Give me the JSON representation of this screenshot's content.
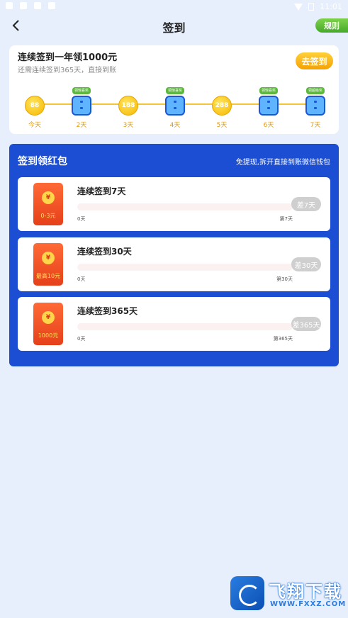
{
  "status_bar": {
    "time": "11:01"
  },
  "header": {
    "title": "签到",
    "rules_label": "规则"
  },
  "signin": {
    "title": "连续签到一年领1000元",
    "subtitle": "还需连续签到365天，直接到账",
    "button_label": "去签到",
    "days": [
      {
        "type": "coin",
        "value": "88",
        "label": "今天",
        "tag": ""
      },
      {
        "type": "gift",
        "value": "",
        "label": "2天",
        "tag": "领惊喜奖"
      },
      {
        "type": "coin",
        "value": "188",
        "label": "3天",
        "tag": ""
      },
      {
        "type": "gift",
        "value": "",
        "label": "4天",
        "tag": "领惊喜奖"
      },
      {
        "type": "coin",
        "value": "288",
        "label": "5天",
        "tag": ""
      },
      {
        "type": "gift",
        "value": "",
        "label": "6天",
        "tag": "领惊喜奖"
      },
      {
        "type": "gift",
        "value": "",
        "label": "7天",
        "tag": "领超级奖"
      }
    ]
  },
  "red_packet": {
    "title": "签到领红包",
    "note": "免提现,拆开直接到账微信钱包",
    "rewards": [
      {
        "envelope_amount": "0-3元",
        "title": "连续签到7天",
        "progress": 0,
        "start_label": "0天",
        "end_label": "第7天",
        "remaining": "差7天"
      },
      {
        "envelope_amount": "最高10元",
        "title": "连续签到30天",
        "progress": 0,
        "start_label": "0天",
        "end_label": "第30天",
        "remaining": "差30天"
      },
      {
        "envelope_amount": "1000元",
        "title": "连续签到365天",
        "progress": 0,
        "start_label": "0天",
        "end_label": "第365天",
        "remaining": "差365天"
      }
    ],
    "seal_symbol": "¥"
  },
  "watermark": {
    "text": "飞翔下载",
    "sub": "WWW.FXXZ.COM"
  },
  "colors": {
    "accent_blue": "#1c4ed4",
    "coin_gold": "#f6b800",
    "green": "#5eb83f"
  }
}
